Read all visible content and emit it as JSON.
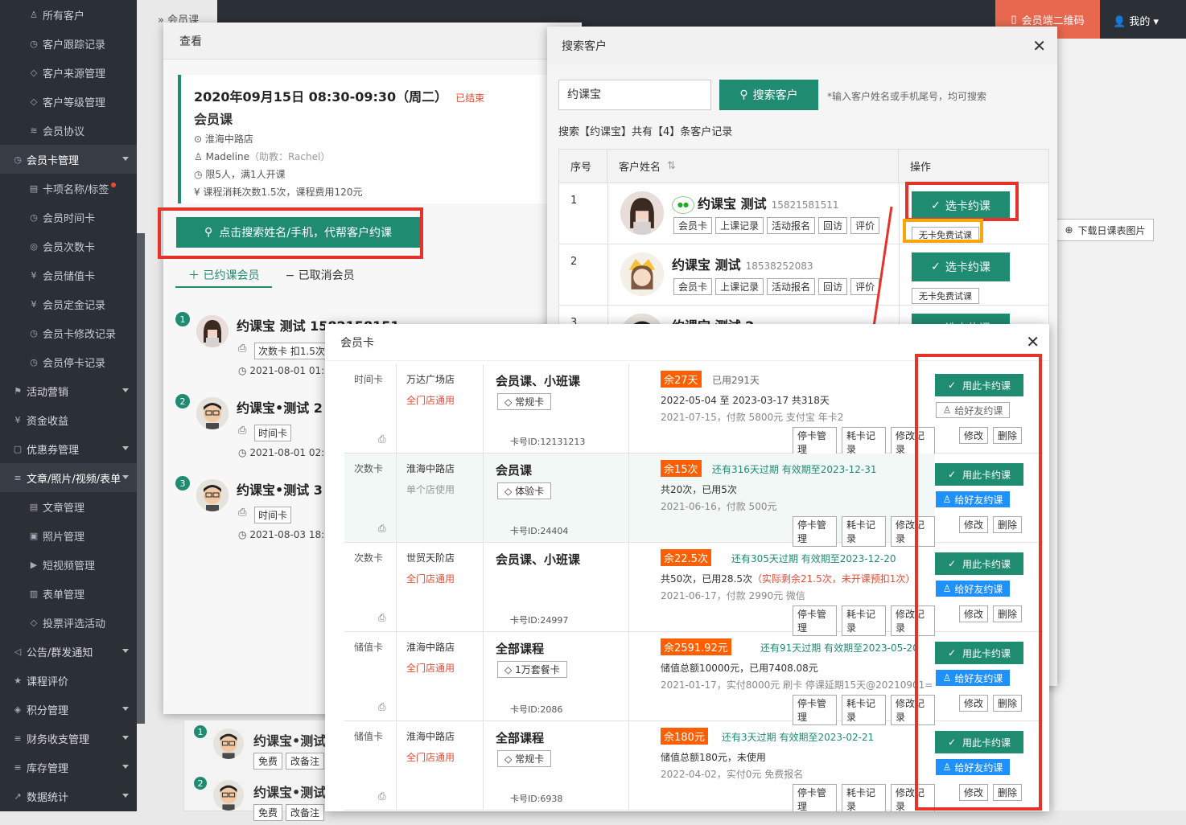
{
  "sidebar": {
    "items": [
      {
        "label": "所有客户",
        "icon": "user-icon",
        "level": "sub"
      },
      {
        "label": "客户跟踪记录",
        "icon": "clock-icon",
        "level": "sub"
      },
      {
        "label": "客户来源管理",
        "icon": "tag-icon",
        "level": "sub"
      },
      {
        "label": "客户等级管理",
        "icon": "tag-icon",
        "level": "sub"
      },
      {
        "label": "会员协议",
        "icon": "layers-icon",
        "level": "sub"
      },
      {
        "label": "会员卡管理",
        "icon": "clock-icon",
        "level": "head"
      },
      {
        "label": "卡项名称/标签",
        "icon": "doc-icon",
        "level": "sub"
      },
      {
        "label": "会员时间卡",
        "icon": "clock-icon",
        "level": "sub"
      },
      {
        "label": "会员次数卡",
        "icon": "coin-icon",
        "level": "sub"
      },
      {
        "label": "会员储值卡",
        "icon": "yen-icon",
        "level": "sub"
      },
      {
        "label": "会员定金记录",
        "icon": "yen-icon",
        "level": "sub"
      },
      {
        "label": "会员卡修改记录",
        "icon": "clock-icon",
        "level": "sub"
      },
      {
        "label": "会员停卡记录",
        "icon": "clock-icon",
        "level": "sub"
      },
      {
        "label": "活动营销",
        "icon": "flag-icon",
        "level": "top"
      },
      {
        "label": "资金收益",
        "icon": "yen-icon",
        "level": "top"
      },
      {
        "label": "优惠券管理",
        "icon": "coupon-icon",
        "level": "top"
      },
      {
        "label": "文章/照片/视频/表单",
        "icon": "list-icon",
        "level": "head"
      },
      {
        "label": "文章管理",
        "icon": "doc-icon",
        "level": "sub"
      },
      {
        "label": "照片管理",
        "icon": "image-icon",
        "level": "sub"
      },
      {
        "label": "短视频管理",
        "icon": "play-icon",
        "level": "sub"
      },
      {
        "label": "表单管理",
        "icon": "form-icon",
        "level": "sub"
      },
      {
        "label": "投票评选活动",
        "icon": "tag-icon",
        "level": "sub"
      },
      {
        "label": "公告/群发通知",
        "icon": "speaker-icon",
        "level": "top"
      },
      {
        "label": "课程评价",
        "icon": "star-icon",
        "level": "top"
      },
      {
        "label": "积分管理",
        "icon": "diamond-icon",
        "level": "top"
      },
      {
        "label": "财务收支管理",
        "icon": "list-icon",
        "level": "top"
      },
      {
        "label": "库存管理",
        "icon": "list-icon",
        "level": "top"
      },
      {
        "label": "数据统计",
        "icon": "chart-icon",
        "level": "top"
      }
    ]
  },
  "topbar": {
    "member_qr": "会员端二维码",
    "me": "我的",
    "crumb": "会员课"
  },
  "download_btn": "下载日课表图片",
  "view_modal": {
    "title": "查看",
    "date": "2020年09月15日 08:30-09:30（周二）",
    "status": "已结束",
    "course": "会员课",
    "store": "淮海中路店",
    "teacher": "Madeline",
    "assistant": "（助教：Rachel）",
    "limit": "限5人，满1人开课",
    "cost": "课程消耗次数1.5次，课程费用120元",
    "search_btn": "点击搜索姓名/手机，代帮客户约课",
    "tab_booked": "已约课会员",
    "tab_cancelled": "已取消会员",
    "members": [
      {
        "num": "1",
        "name": "约课宝 测试 1582158151",
        "tag": "次数卡 扣1.5次",
        "time": "2021-08-01 01:1"
      },
      {
        "num": "2",
        "name": "约课宝•测试 2",
        "tag": "时间卡",
        "time": "2021-08-01 02:0"
      },
      {
        "num": "3",
        "name": "约课宝•测试 3",
        "tag": "时间卡",
        "time": "2021-08-03 18:5"
      }
    ],
    "sub_members": [
      {
        "num": "1",
        "name": "约课宝•测试",
        "tag": "免费",
        "tag2": "改备注"
      },
      {
        "num": "2",
        "name": "约课宝•测试",
        "tag": "免费",
        "tag2": "改备注"
      }
    ]
  },
  "search_modal": {
    "title": "搜索客户",
    "input_value": "约课宝",
    "search_btn": "搜索客户",
    "hint": "*输入客户姓名或手机尾号，均可搜索",
    "count": "搜索【约课宝】共有【4】条客户记录",
    "headers": [
      "序号",
      "客户姓名",
      "操作"
    ],
    "rows": [
      {
        "num": "1",
        "name": "约课宝 测试",
        "phone": "15821581511",
        "tags": [
          "会员卡",
          "上课记录",
          "活动报名",
          "回访",
          "评价"
        ],
        "select": "选卡约课",
        "free": "无卡免费试课"
      },
      {
        "num": "2",
        "name": "约课宝 测试",
        "phone": "18538252083",
        "tags": [
          "会员卡",
          "上课记录",
          "活动报名",
          "回访",
          "评价"
        ],
        "select": "选卡约课",
        "free": "无卡免费试课"
      },
      {
        "num": "3",
        "name": "约课宝 测试 2",
        "phone": "",
        "tags": [],
        "select": "选卡约课",
        "free": ""
      }
    ]
  },
  "card_modal": {
    "title": "会员卡",
    "use_btn": "用此卡约课",
    "friend_btn": "给好友约课",
    "edit": "修改",
    "delete": "删除",
    "ops": [
      "停卡管理",
      "耗卡记录",
      "修改记录"
    ],
    "rows": [
      {
        "type": "时间卡",
        "store": "万达广场店",
        "scope": "全门店通用",
        "scope_color": "#e64c35",
        "course": "会员课、小班课",
        "tag": "常规卡",
        "card_id": "卡号ID:12131213",
        "remain": "余27天",
        "exp": "已用291天",
        "exp_color": "#666",
        "line2": "2022-05-04 至 2023-03-17  共318天",
        "line3": "2021-07-15，付款 5800元 支付宝 年卡2",
        "friend_active": false
      },
      {
        "type": "次数卡",
        "store": "淮海中路店",
        "scope": "单个店使用",
        "scope_color": "#999",
        "course": "会员课",
        "tag": "体验卡",
        "card_id": "卡号ID:24404",
        "remain": "余15次",
        "exp": "还有316天过期  有效期至2023-12-31",
        "exp_color": "#1f8c72",
        "line2": "共20次，已用5次",
        "line3": "2021-06-16，付款 500元",
        "friend_active": true
      },
      {
        "type": "次数卡",
        "store": "世贸天阶店",
        "scope": "全门店通用",
        "scope_color": "#e64c35",
        "course": "会员课、小班课",
        "tag": "",
        "card_id": "卡号ID:24997",
        "remain": "余22.5次",
        "exp": "还有305天过期  有效期至2023-12-20",
        "exp_color": "#1f8c72",
        "line2": "共50次，已用28.5次",
        "line2b": "（实际剩余21.5次，未开课预扣1次）",
        "line3": "2021-06-17，付款 2990元 微信",
        "friend_active": true
      },
      {
        "type": "储值卡",
        "store": "淮海中路店",
        "scope": "全门店通用",
        "scope_color": "#e64c35",
        "course": "全部课程",
        "tag": "1万套餐卡",
        "card_id": "卡号ID:2086",
        "remain": "余2591.92元",
        "exp": "还有91天过期  有效期至2023-05-20",
        "exp_color": "#1f8c72",
        "line2": "储值总额10000元，已用7408.08元",
        "line3": "2021-01-17，实付8000元 刷卡 停课延期15天@20210901=",
        "friend_active": true
      },
      {
        "type": "储值卡",
        "store": "淮海中路店",
        "scope": "全门店通用",
        "scope_color": "#e64c35",
        "course": "全部课程",
        "tag": "常规卡",
        "card_id": "卡号ID:6938",
        "remain": "余180元",
        "exp": "还有3天过期  有效期至2023-02-21",
        "exp_color": "#1f8c72",
        "line2": "储值总额180元，未使用",
        "line3": "2022-04-02，实付0元 免费报名",
        "friend_active": true
      }
    ]
  },
  "colors": {
    "primary": "#1f8c72",
    "danger": "#e64c35",
    "highlight": "#e6332a",
    "warning": "#f5a70c",
    "friend": "#1e90ff"
  }
}
